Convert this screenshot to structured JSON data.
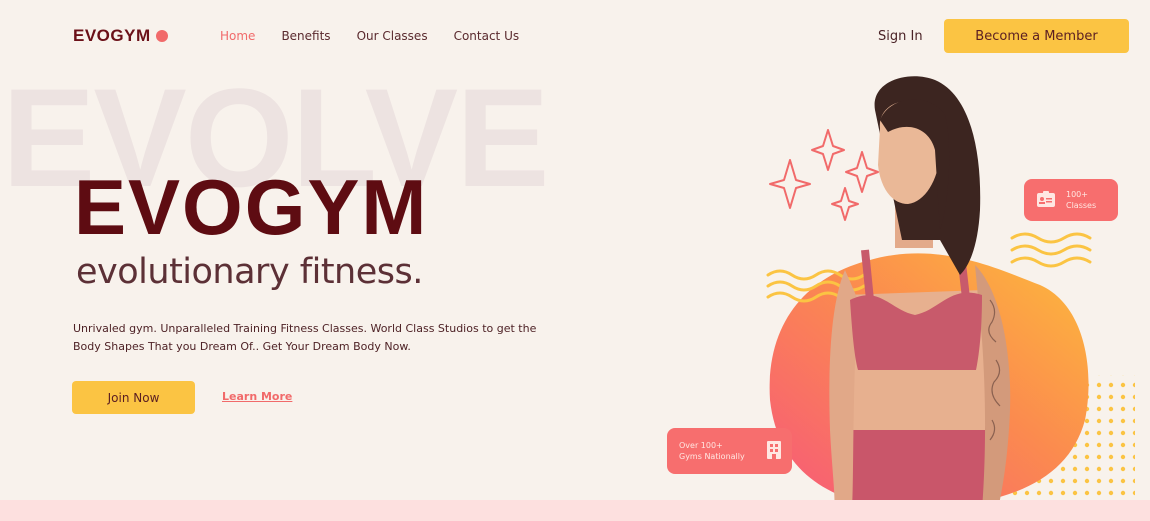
{
  "nav": {
    "logo": "EVOGYM",
    "links": [
      "Home",
      "Benefits",
      "Our Classes",
      "Contact Us"
    ],
    "sign_in": "Sign In",
    "cta": "Become a Member"
  },
  "hero": {
    "watermark": "EVOLVE",
    "title": "EVOGYM",
    "subtitle": "evolutionary fitness.",
    "description": "Unrivaled gym. Unparalleled Training Fitness Classes. World Class Studios to get the Body Shapes That you Dream Of.. Get Your Dream Body Now.",
    "primary_button": "Join Now",
    "secondary_link": "Learn More"
  },
  "badges": {
    "classes_line1": "100+",
    "classes_line2": "Classes",
    "gyms_line1": "Over 100+",
    "gyms_line2": "Gyms Nationally"
  },
  "colors": {
    "background": "#f8f2ec",
    "brand_dark": "#5e0c12",
    "accent_coral": "#f16a6a",
    "accent_yellow": "#fbc443"
  }
}
